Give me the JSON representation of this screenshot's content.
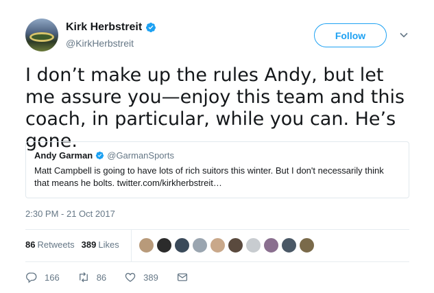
{
  "author": {
    "name": "Kirk Herbstreit",
    "handle": "@KirkHerbstreit"
  },
  "follow_label": "Follow",
  "tweet_text": "I don’t make up the rules Andy, but let me assure you—enjoy this team and this coach, in particular,  while you can. He’s gone.",
  "quoted": {
    "name": "Andy Garman",
    "handle": "@GarmanSports",
    "text": "Matt Campbell is going to have lots of rich suitors this winter. But I don't necessarily think that means he bolts. twitter.com/kirkherbstreit…"
  },
  "timestamp": "2:30 PM - 21 Oct 2017",
  "stats": {
    "retweets_count": "86",
    "retweets_label": "Retweets",
    "likes_count": "389",
    "likes_label": "Likes"
  },
  "actions": {
    "reply_count": "166",
    "retweet_count": "86",
    "like_count": "389"
  },
  "colors": {
    "accent": "#1da1f2",
    "secondary_text": "#657786",
    "liker_avatars": [
      "#b89a7a",
      "#2b2b2b",
      "#3a4a5a",
      "#9aa5b0",
      "#c9a88a",
      "#5a4a3e",
      "#c8ccd0",
      "#8a6f8f",
      "#4a5866",
      "#7a6a4a"
    ]
  }
}
